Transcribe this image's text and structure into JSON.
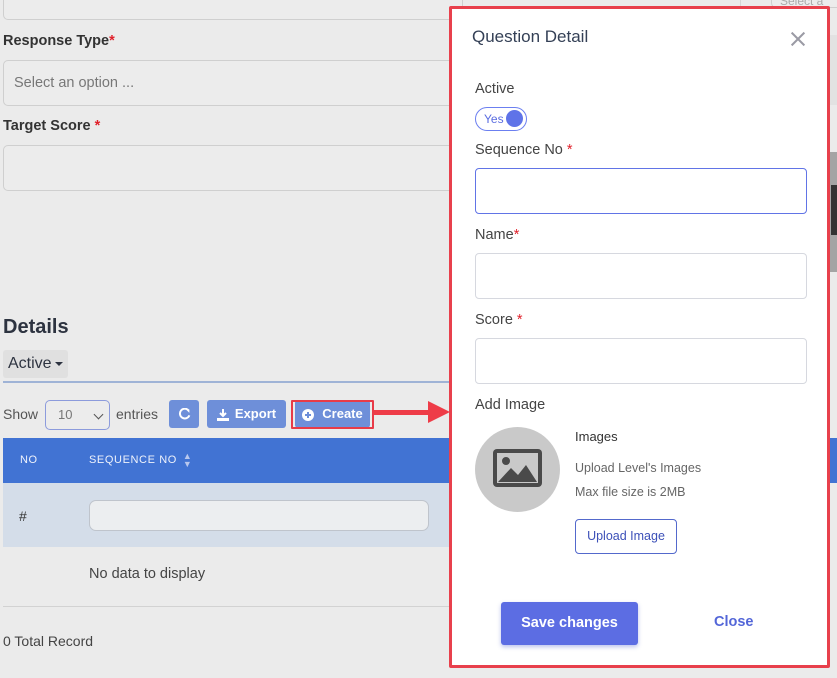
{
  "background": {
    "top_select_fragment": "Select a",
    "response_type_label": "Response Type",
    "response_type_placeholder": "Select an option ...",
    "target_score_label": "Target Score",
    "required_mark": "*",
    "details_title": "Details",
    "status_filter": "Active",
    "show_label": "Show",
    "entries_value": "10",
    "entries_label": "entries",
    "export_label": "Export",
    "create_label": "Create",
    "table": {
      "columns": [
        "NO",
        "SEQUENCE NO"
      ],
      "filter_row_marker": "#",
      "empty_text": "No data to display"
    },
    "total_record": "0 Total Record",
    "colors": {
      "table_header": "#4173d3",
      "buttons": "#6e8fd9",
      "highlight": "#e83b48"
    }
  },
  "modal": {
    "title": "Question Detail",
    "active_label": "Active",
    "toggle_text": "Yes",
    "sequence_label": "Sequence No",
    "name_label": "Name",
    "score_label": "Score",
    "required_mark": "*",
    "add_image_label": "Add Image",
    "images_title": "Images",
    "images_desc_1": "Upload Level's Images",
    "images_desc_2": "Max file size is 2MB",
    "upload_label": "Upload Image",
    "save_label": "Save changes",
    "close_label": "Close",
    "colors": {
      "primary": "#5c6de3",
      "border_highlight": "#e8404c"
    }
  },
  "icons": [
    "refresh-icon",
    "download-icon",
    "plus-circle-icon",
    "sort-icon",
    "image-icon",
    "close-icon",
    "caret-down-icon",
    "chevron-down-icon",
    "arrow-right-icon"
  ]
}
